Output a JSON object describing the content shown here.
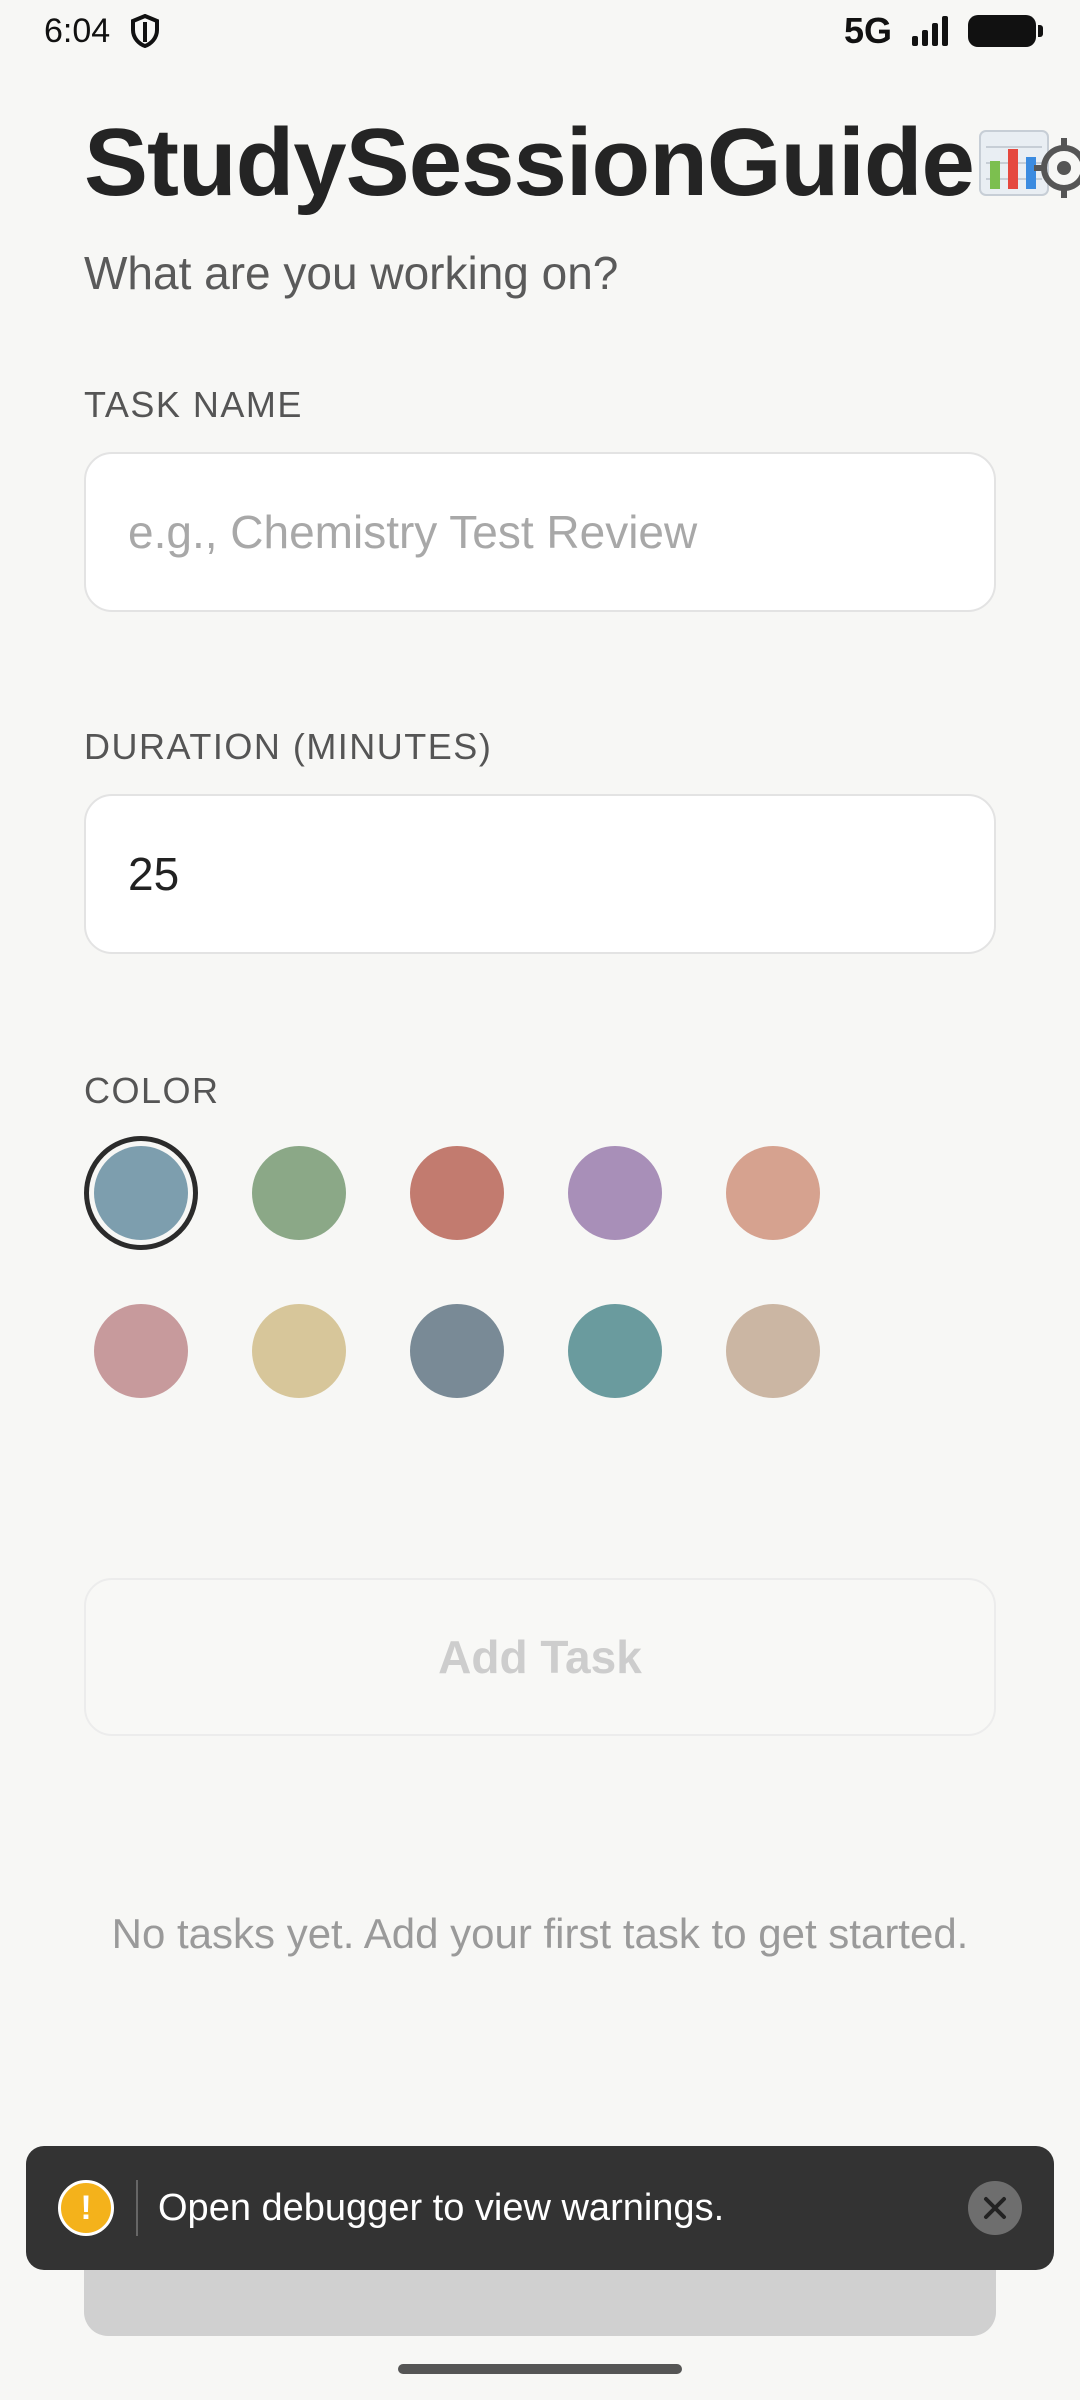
{
  "status": {
    "time": "6:04",
    "network": "5G"
  },
  "header": {
    "title": "StudySessionGuide",
    "subtitle": "What are you working on?"
  },
  "task_name": {
    "label": "TASK NAME",
    "placeholder": "e.g., Chemistry Test Review",
    "value": ""
  },
  "duration": {
    "label": "DURATION (MINUTES)",
    "value": "25"
  },
  "color": {
    "label": "COLOR",
    "selected_index": 0,
    "options": [
      "#7d9eae",
      "#8ba887",
      "#c27b6f",
      "#a88fb8",
      "#d6a28f",
      "#c79a9c",
      "#d7c69a",
      "#798a96",
      "#6a9b9e",
      "#cbb6a3"
    ]
  },
  "add_button": {
    "label": "Add Task"
  },
  "empty_state": {
    "message": "No tasks yet. Add your first task to get started."
  },
  "toast": {
    "message": "Open debugger to view warnings.",
    "icon": "!"
  }
}
